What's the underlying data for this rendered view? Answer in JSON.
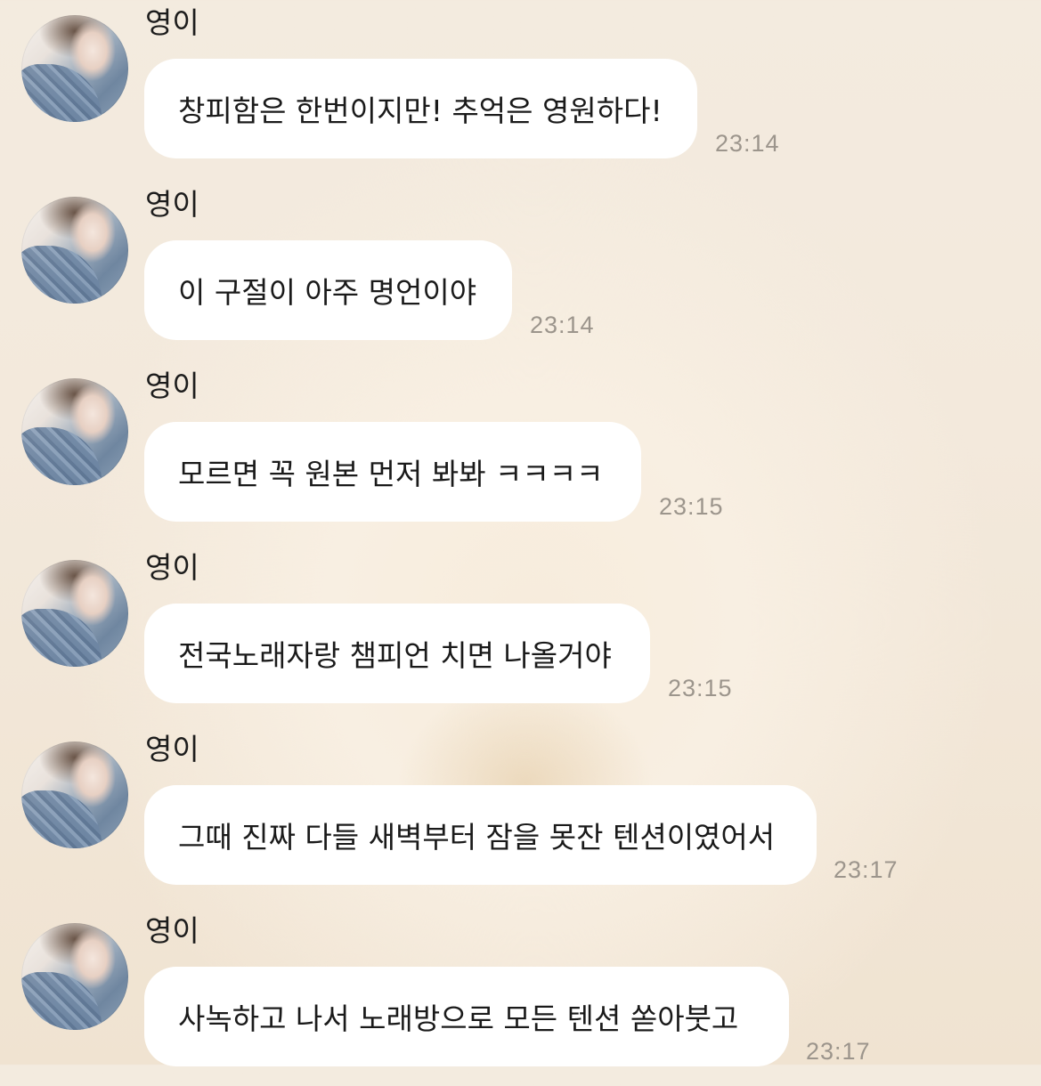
{
  "messages": [
    {
      "sender": "영이",
      "text": "창피함은 한번이지만! 추억은 영원하다!",
      "time": "23:14"
    },
    {
      "sender": "영이",
      "text": "이 구절이 아주 명언이야",
      "time": "23:14"
    },
    {
      "sender": "영이",
      "text": "모르면 꼭 원본 먼저 봐봐 ㅋㅋㅋㅋ",
      "time": "23:15"
    },
    {
      "sender": "영이",
      "text": "전국노래자랑 챔피언 치면 나올거야",
      "time": "23:15"
    },
    {
      "sender": "영이",
      "text": "그때 진짜 다들 새벽부터 잠을 못잔 텐션이였어서",
      "time": "23:17"
    },
    {
      "sender": "영이",
      "text": "사녹하고 나서 노래방으로 모든 텐션 쏟아붓고",
      "time": "23:17"
    }
  ],
  "colors": {
    "bubble": "#ffffff",
    "timestamp": "#9c958c",
    "background": "#f3ebdf"
  }
}
